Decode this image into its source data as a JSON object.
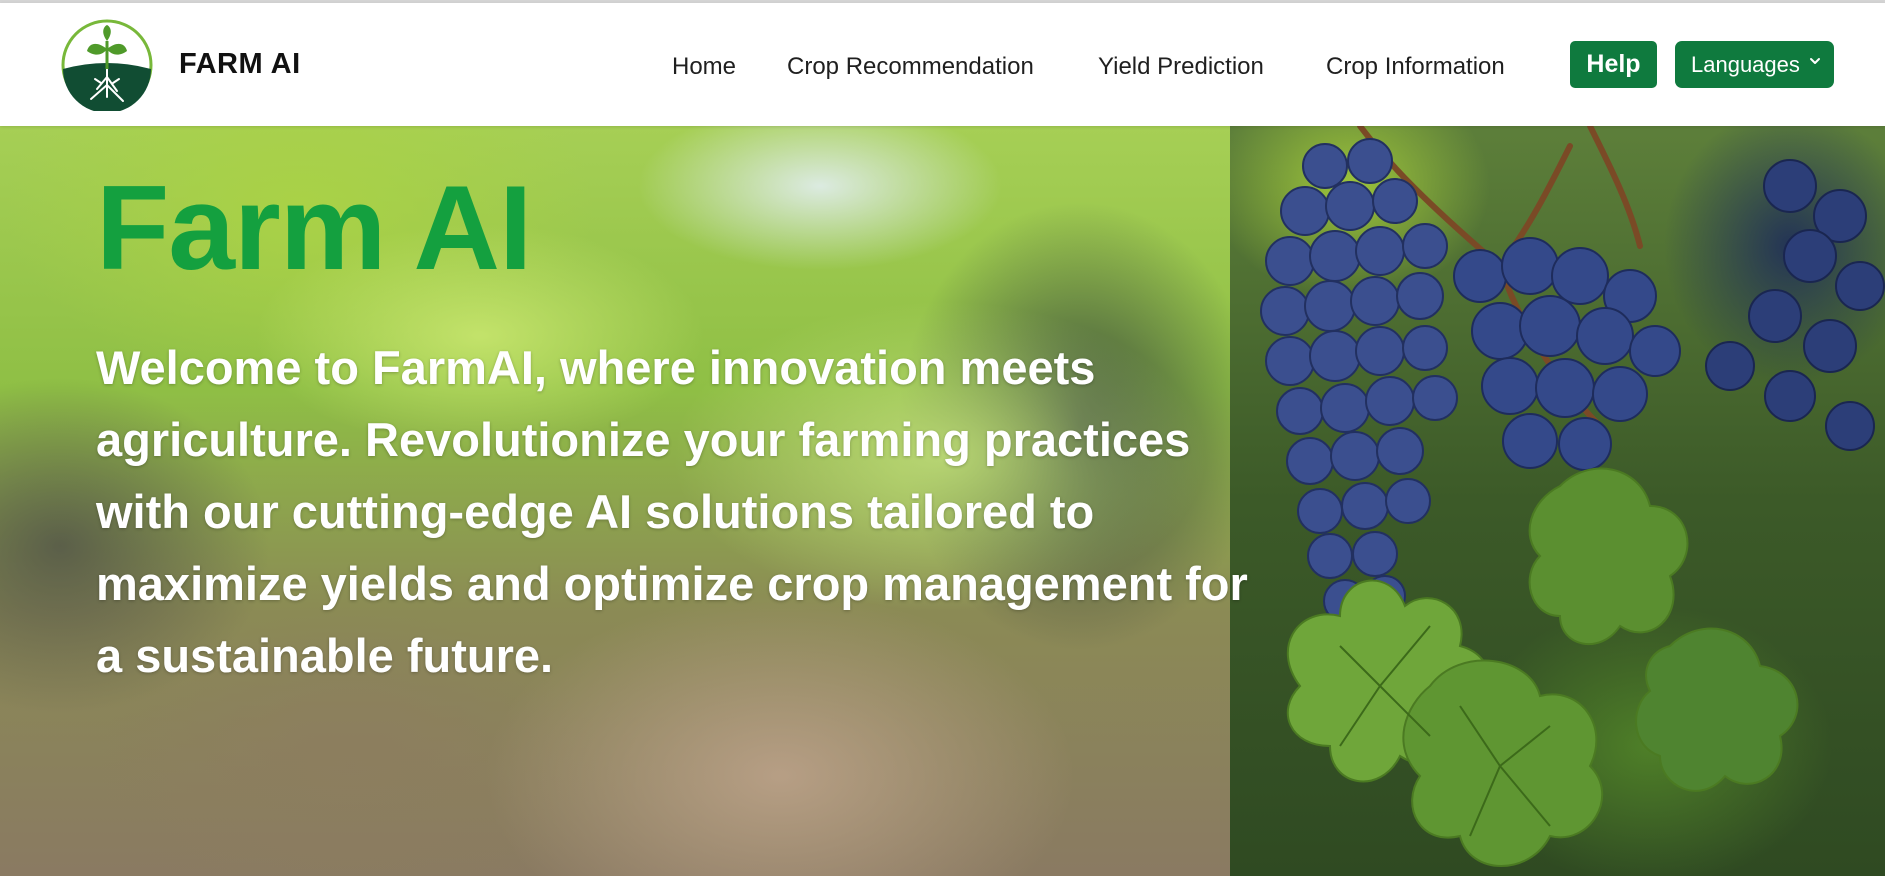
{
  "header": {
    "brand": "FARM AI",
    "logo_icon": "sprout-roots-logo-icon",
    "nav": {
      "home": "Home",
      "crop_recommendation": "Crop Recommendation",
      "yield_prediction": "Yield Prediction",
      "crop_information": "Crop Information"
    },
    "help_label": "Help",
    "languages_label": "Languages",
    "languages_icon": "chevron-down-icon"
  },
  "hero": {
    "title": "Farm AI",
    "text": "Welcome to FarmAI, where innovation meets agriculture. Revolutionize your farming practices with our cutting-edge AI solutions tailored to maximize yields and optimize crop management for a sustainable future.",
    "background": "vineyard-grapes-photo"
  },
  "colors": {
    "accent_green": "#0f7a3e",
    "title_green": "#14a03f",
    "logo_dark_green": "#114d33",
    "logo_light_green": "#78b83a"
  }
}
